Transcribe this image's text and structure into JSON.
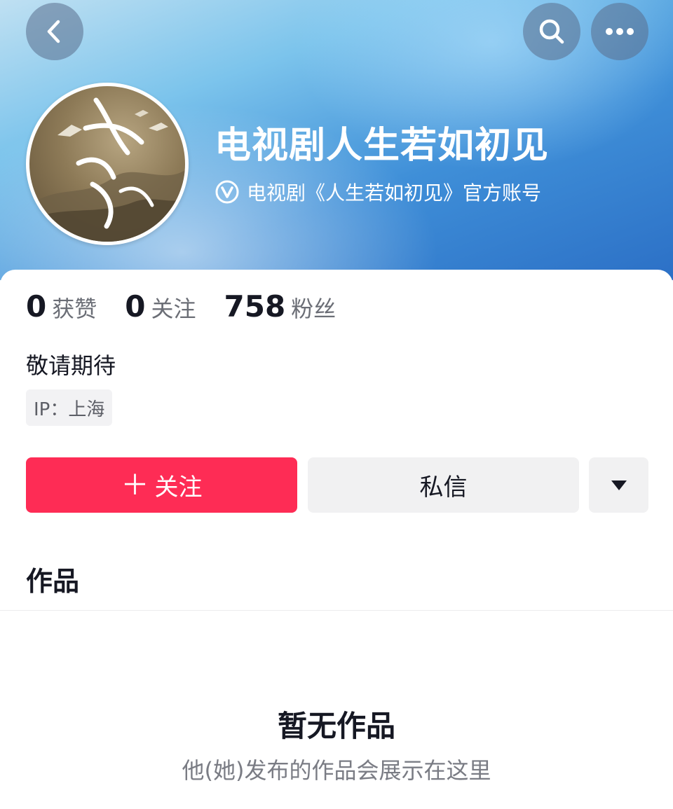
{
  "header": {
    "back_icon": "chevron-left-icon",
    "search_icon": "search-icon",
    "more_icon": "more-horizontal-icon",
    "banner_colors": [
      "#bfe0f2",
      "#3f8fd8",
      "#2c70c6"
    ]
  },
  "profile": {
    "name": "电视剧人生若如初见",
    "verified_icon": "verified-badge-icon",
    "verified_text": "电视剧《人生若如初见》官方账号",
    "avatar_text": "人生若如初見",
    "bio": "敬请期待",
    "ip_label": "IP：上海"
  },
  "stats": [
    {
      "value": "0",
      "label": "获赞"
    },
    {
      "value": "0",
      "label": "关注"
    },
    {
      "value": "758",
      "label": "粉丝"
    }
  ],
  "actions": {
    "follow_icon": "plus-icon",
    "follow_label": "关注",
    "message_label": "私信",
    "dropdown_icon": "caret-down-icon",
    "follow_color": "#fe2c55"
  },
  "tabs": {
    "works_label": "作品"
  },
  "empty_state": {
    "title": "暂无作品",
    "subtitle": "他(她)发布的作品会展示在这里"
  }
}
